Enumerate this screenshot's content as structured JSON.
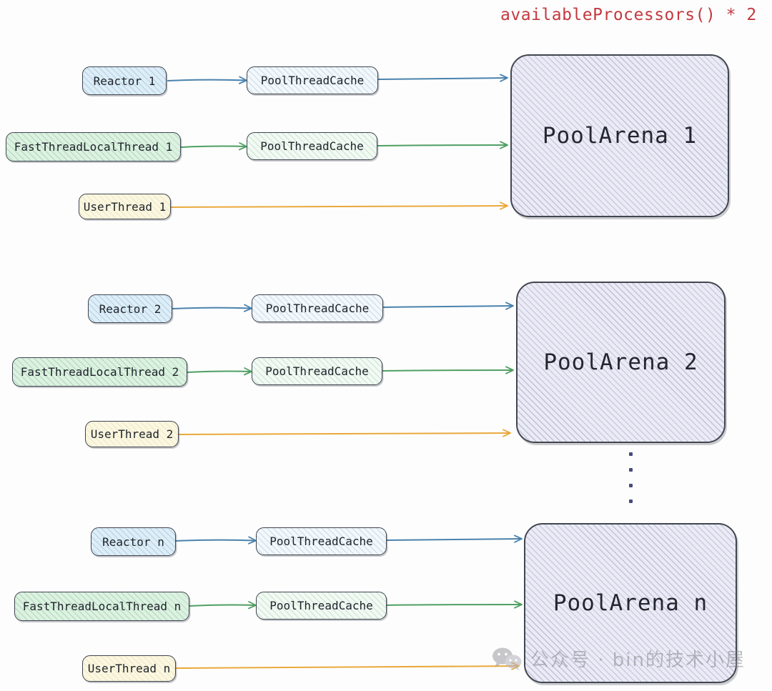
{
  "title": {
    "text": "availableProcessors() * 2",
    "color": "#c4393f"
  },
  "rows": [
    {
      "index": "1",
      "reactor": {
        "label": "Reactor 1",
        "icon": "reactor-node-icon",
        "color": "#ddeef8"
      },
      "fast_thread": {
        "label": "FastThreadLocalThread 1",
        "color": "#dcf2e1"
      },
      "user_thread": {
        "label": "UserThread 1",
        "color": "#fbf7e0"
      },
      "cache_top": {
        "label": "PoolThreadCache"
      },
      "cache_mid": {
        "label": "PoolThreadCache"
      },
      "arena": {
        "label": "PoolArena 1"
      }
    },
    {
      "index": "2",
      "reactor": {
        "label": "Reactor 2",
        "icon": "reactor-node-icon",
        "color": "#ddeef8"
      },
      "fast_thread": {
        "label": "FastThreadLocalThread 2",
        "color": "#dcf2e1"
      },
      "user_thread": {
        "label": "UserThread 2",
        "color": "#fbf7e0"
      },
      "cache_top": {
        "label": "PoolThreadCache"
      },
      "cache_mid": {
        "label": "PoolThreadCache"
      },
      "arena": {
        "label": "PoolArena 2"
      }
    },
    {
      "index": "n",
      "reactor": {
        "label": "Reactor n",
        "icon": "reactor-node-icon",
        "color": "#ddeef8"
      },
      "fast_thread": {
        "label": "FastThreadLocalThread n",
        "color": "#dcf2e1"
      },
      "user_thread": {
        "label": "UserThread n",
        "color": "#fbf7e0"
      },
      "cache_top": {
        "label": "PoolThreadCache"
      },
      "cache_mid": {
        "label": "PoolThreadCache"
      },
      "arena": {
        "label": "PoolArena n"
      }
    }
  ],
  "arrow_colors": {
    "reactor": "#4a82ad",
    "fast_thread": "#4f9f63",
    "user_thread": "#eaa93c"
  },
  "ellipsis": {
    "dot_count": 4,
    "color": "#4a4a82"
  },
  "watermark": {
    "text": "公众号 · bin的技术小屋",
    "icon": "wechat-icon"
  }
}
